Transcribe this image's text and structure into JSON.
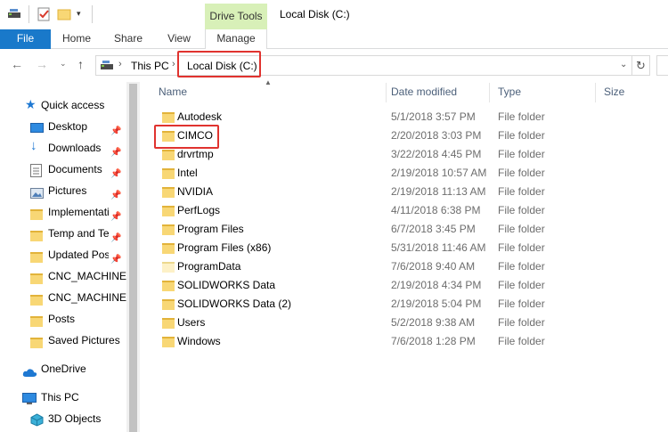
{
  "window": {
    "title": "Local Disk (C:)",
    "context_group": "Drive Tools"
  },
  "ribbon": {
    "tabs": [
      {
        "label": "File"
      },
      {
        "label": "Home"
      },
      {
        "label": "Share"
      },
      {
        "label": "View"
      },
      {
        "label": "Manage"
      }
    ]
  },
  "address": {
    "segments": [
      "This PC",
      "Local Disk (C:)"
    ]
  },
  "columns": {
    "name": "Name",
    "date": "Date modified",
    "type": "Type",
    "size": "Size"
  },
  "sidebar": {
    "items": [
      {
        "label": "Quick access",
        "icon": "star-icon",
        "pinned": false
      },
      {
        "label": "Desktop",
        "icon": "desktop-icon",
        "pinned": true
      },
      {
        "label": "Downloads",
        "icon": "download-icon",
        "pinned": true
      },
      {
        "label": "Documents",
        "icon": "documents-icon",
        "pinned": true
      },
      {
        "label": "Pictures",
        "icon": "pictures-icon",
        "pinned": true
      },
      {
        "label": "Implementatio",
        "icon": "folder-icon",
        "pinned": true
      },
      {
        "label": "Temp and Tes",
        "icon": "folder-icon",
        "pinned": true
      },
      {
        "label": "Updated Post",
        "icon": "folder-icon",
        "pinned": true
      },
      {
        "label": "CNC_MACHINES",
        "icon": "folder-icon",
        "pinned": false
      },
      {
        "label": "CNC_MACHINES",
        "icon": "folder-icon",
        "pinned": false
      },
      {
        "label": "Posts",
        "icon": "folder-icon",
        "pinned": false
      },
      {
        "label": "Saved Pictures",
        "icon": "folder-icon",
        "pinned": false
      },
      {
        "label": "OneDrive",
        "icon": "cloud-icon",
        "pinned": false
      },
      {
        "label": "This PC",
        "icon": "computer-icon",
        "pinned": false
      },
      {
        "label": "3D Objects",
        "icon": "cube-icon",
        "pinned": false
      }
    ]
  },
  "files": [
    {
      "name": "Autodesk",
      "date": "5/1/2018 3:57 PM",
      "type": "File folder"
    },
    {
      "name": "CIMCO",
      "date": "2/20/2018 3:03 PM",
      "type": "File folder"
    },
    {
      "name": "drvrtmp",
      "date": "3/22/2018 4:45 PM",
      "type": "File folder"
    },
    {
      "name": "Intel",
      "date": "2/19/2018 10:57 AM",
      "type": "File folder"
    },
    {
      "name": "NVIDIA",
      "date": "2/19/2018 11:13 AM",
      "type": "File folder"
    },
    {
      "name": "PerfLogs",
      "date": "4/11/2018 6:38 PM",
      "type": "File folder"
    },
    {
      "name": "Program Files",
      "date": "6/7/2018 3:45 PM",
      "type": "File folder"
    },
    {
      "name": "Program Files (x86)",
      "date": "5/31/2018 11:46 AM",
      "type": "File folder"
    },
    {
      "name": "ProgramData",
      "date": "7/6/2018 9:40 AM",
      "type": "File folder"
    },
    {
      "name": "SOLIDWORKS Data",
      "date": "2/19/2018 4:34 PM",
      "type": "File folder"
    },
    {
      "name": "SOLIDWORKS Data (2)",
      "date": "2/19/2018 5:04 PM",
      "type": "File folder"
    },
    {
      "name": "Users",
      "date": "5/2/2018 9:38 AM",
      "type": "File folder"
    },
    {
      "name": "Windows",
      "date": "7/6/2018 1:28 PM",
      "type": "File folder"
    }
  ],
  "colors": {
    "file_tab": "#1979ca",
    "context_group": "#d8f0b8",
    "highlight": "#e0332f",
    "folder": "#f8d775"
  }
}
